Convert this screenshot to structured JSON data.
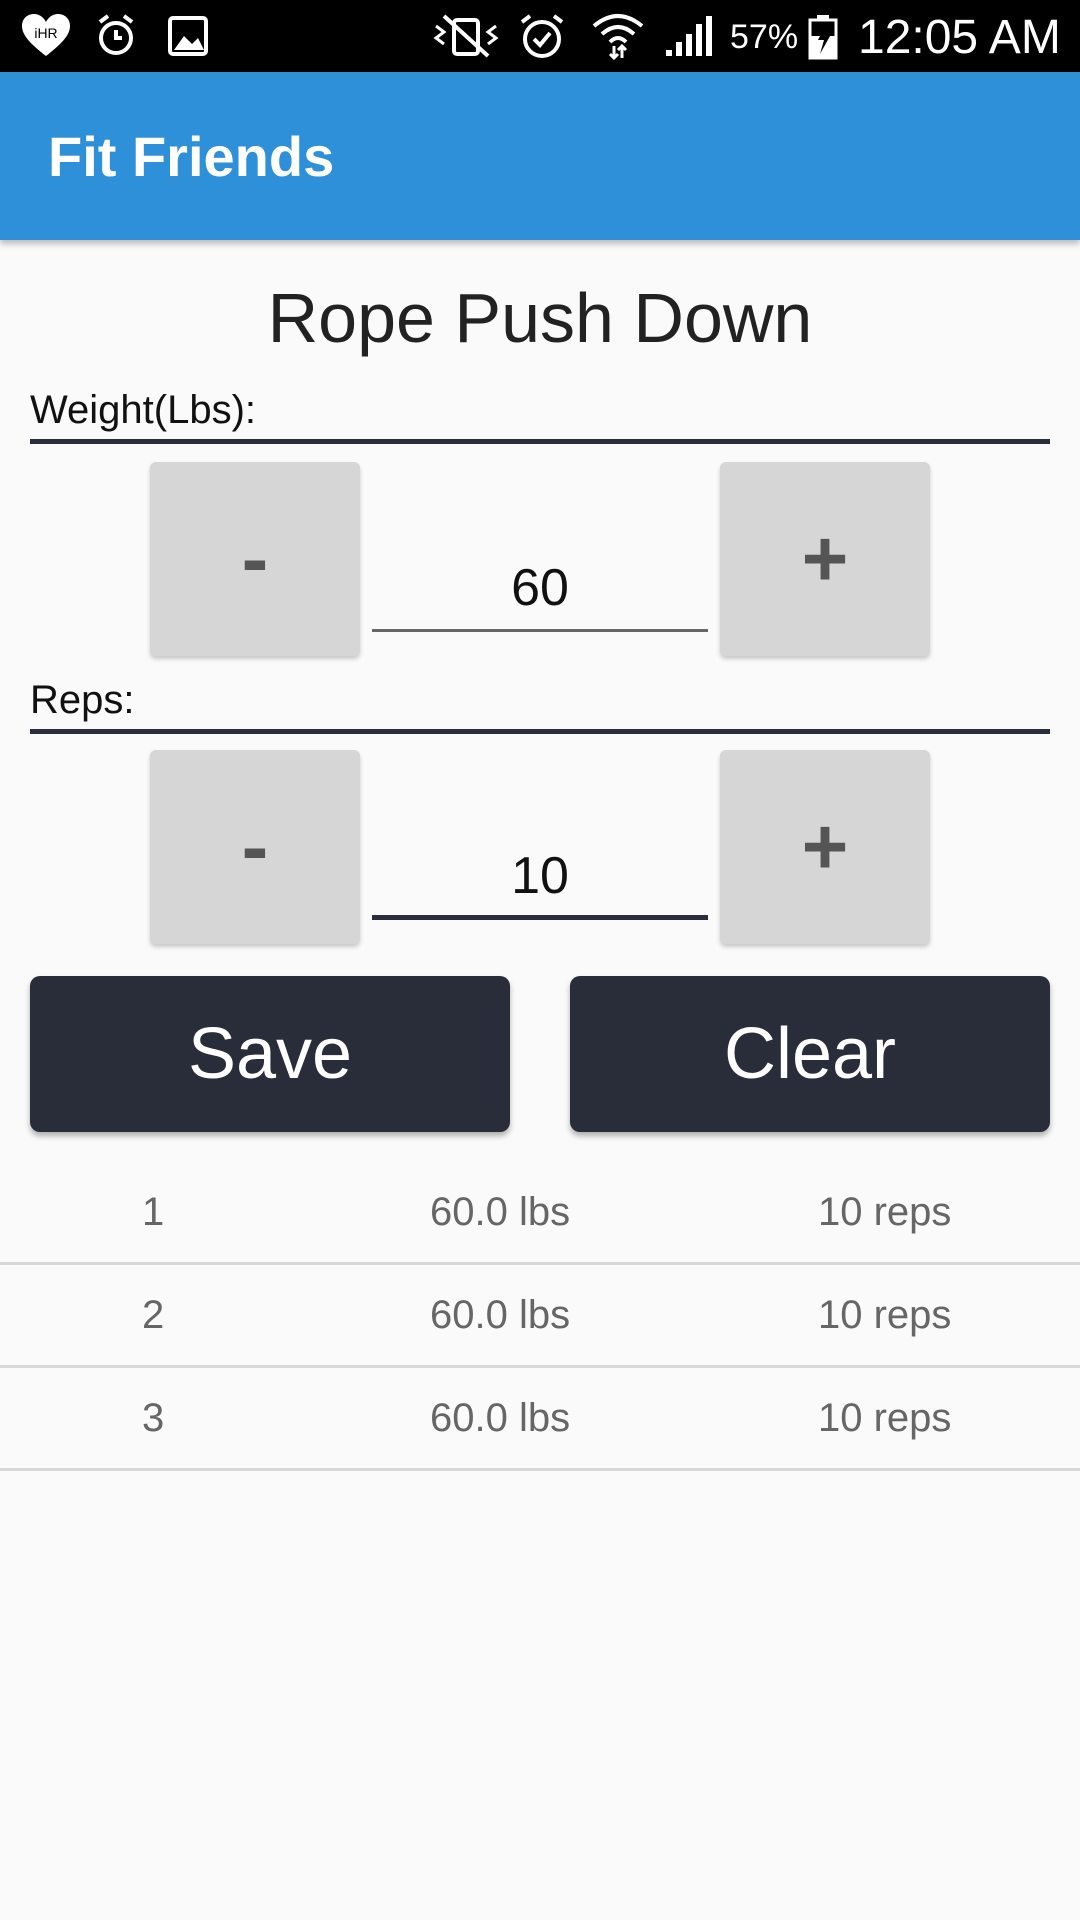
{
  "status_bar": {
    "battery": "57%",
    "time": "12:05 AM",
    "icons": [
      "iheart-icon",
      "alarm-icon",
      "gallery-icon",
      "vibrate-mute-icon",
      "alarm-check-icon",
      "wifi-icon",
      "signal-icon",
      "battery-charging-icon"
    ]
  },
  "app_bar": {
    "title": "Fit Friends",
    "color": "#2d90d9"
  },
  "exercise": {
    "name": "Rope Push Down"
  },
  "weight": {
    "label": "Weight(Lbs):",
    "minus_label": "-",
    "plus_label": "+",
    "value": "60"
  },
  "reps": {
    "label": "Reps:",
    "minus_label": "-",
    "plus_label": "+",
    "value": "10"
  },
  "actions": {
    "save_label": "Save",
    "clear_label": "Clear"
  },
  "sets": [
    {
      "num": "1",
      "weight": "60.0 lbs",
      "reps": "10 reps"
    },
    {
      "num": "2",
      "weight": "60.0 lbs",
      "reps": "10 reps"
    },
    {
      "num": "3",
      "weight": "60.0 lbs",
      "reps": "10 reps"
    }
  ]
}
